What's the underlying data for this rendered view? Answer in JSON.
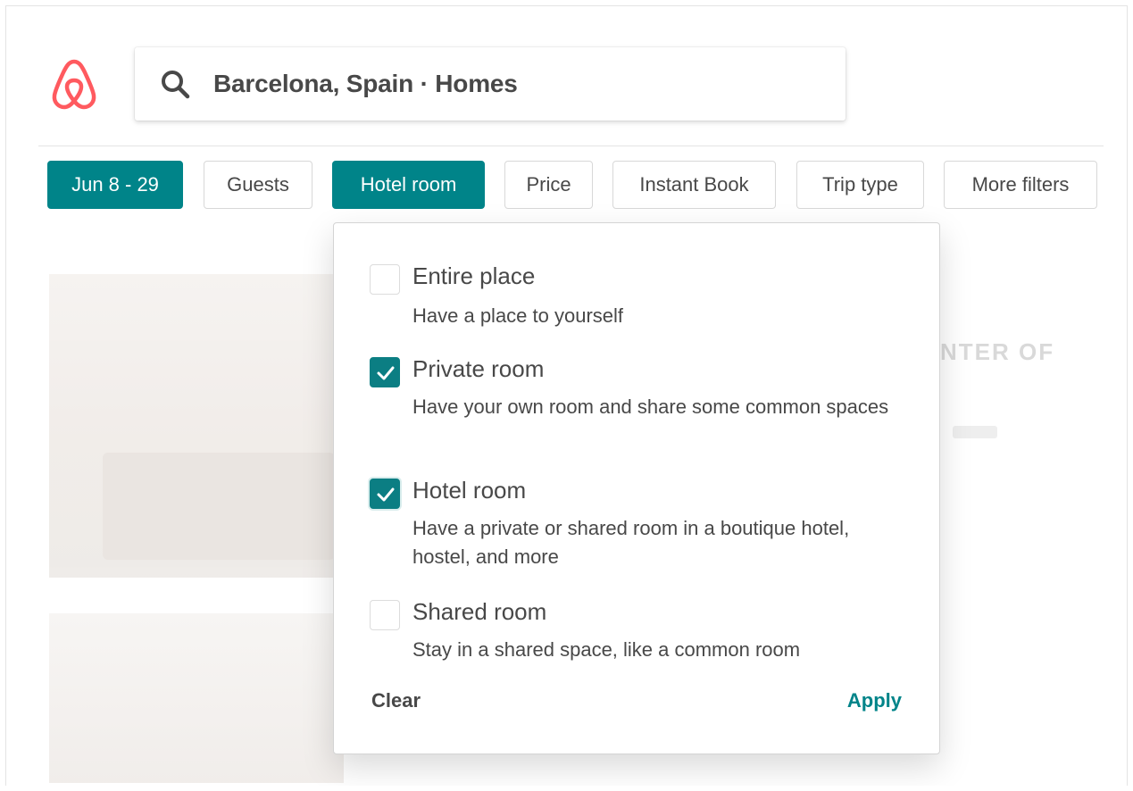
{
  "colors": {
    "brand": "#FF5A5F",
    "accent": "#008489",
    "text": "#484848",
    "border": "#d8d8d8"
  },
  "header": {
    "logo_icon": "airbnb-logo-icon",
    "search_icon": "search-icon",
    "search_text": "Barcelona, Spain · Homes"
  },
  "filters": [
    {
      "label": "Jun 8 - 29",
      "active": true
    },
    {
      "label": "Guests",
      "active": false
    },
    {
      "label": "Hotel room",
      "active": true
    },
    {
      "label": "Price",
      "active": false
    },
    {
      "label": "Instant Book",
      "active": false
    },
    {
      "label": "Trip type",
      "active": false
    },
    {
      "label": "More filters",
      "active": false
    }
  ],
  "dropdown": {
    "options": [
      {
        "title": "Entire place",
        "description": "Have a place to yourself",
        "checked": false
      },
      {
        "title": "Private room",
        "description": "Have your own room and share some common spaces",
        "checked": true
      },
      {
        "title": "Hotel room",
        "description": "Have a private or shared room in a boutique hotel, hostel, and more",
        "checked": true
      },
      {
        "title": "Shared room",
        "description": "Stay in a shared space, like a common room",
        "checked": false
      }
    ],
    "clear_label": "Clear",
    "apply_label": "Apply"
  },
  "background": {
    "listing_fragment": "NTER OF"
  }
}
